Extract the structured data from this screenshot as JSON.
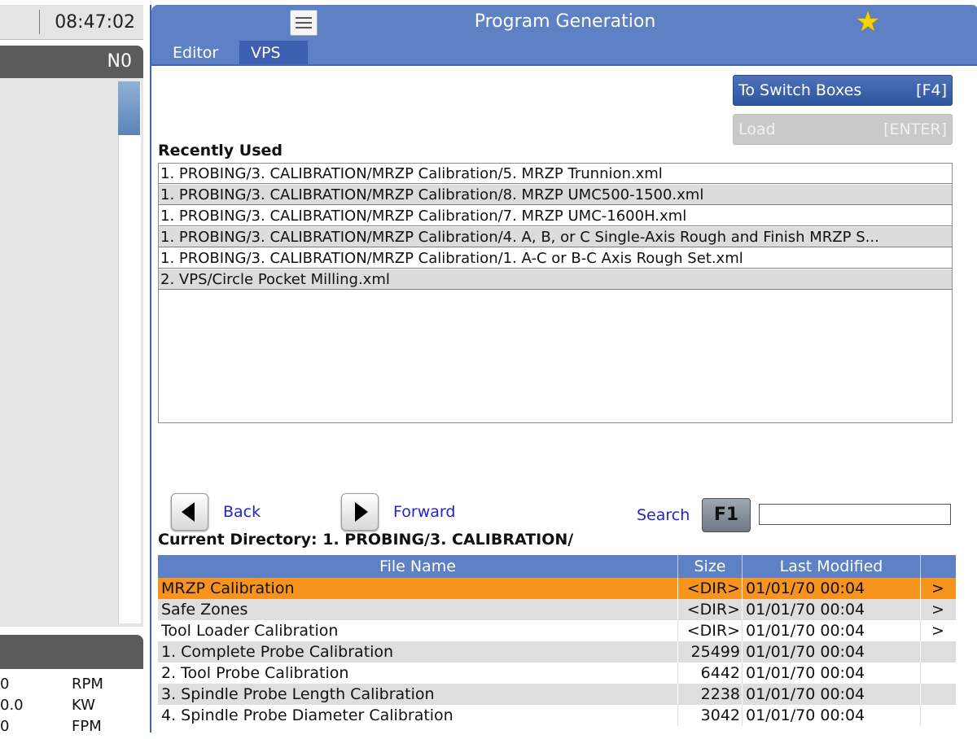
{
  "left_panel": {
    "clock": "08:47:02",
    "n_label": "N0",
    "stats": [
      {
        "value": "0",
        "unit": "RPM"
      },
      {
        "value": "0.0",
        "unit": "KW"
      },
      {
        "value": "0",
        "unit": "FPM"
      }
    ]
  },
  "window": {
    "title": "Program Generation",
    "tabs": [
      {
        "label": "Editor"
      },
      {
        "label": "VPS"
      }
    ],
    "active_tab": "VPS"
  },
  "actions": {
    "switch": {
      "label": "To Switch Boxes",
      "key": "[F4]"
    },
    "load": {
      "label": "Load",
      "key": "[ENTER]"
    }
  },
  "recent": {
    "title": "Recently Used",
    "items": [
      "1. PROBING/3. CALIBRATION/MRZP Calibration/5. MRZP Trunnion.xml",
      "1. PROBING/3. CALIBRATION/MRZP Calibration/8. MRZP UMC500-1500.xml",
      "1. PROBING/3. CALIBRATION/MRZP Calibration/7. MRZP UMC-1600H.xml",
      "1. PROBING/3. CALIBRATION/MRZP Calibration/4. A, B, or C Single-Axis Rough and Finish MRZP S...",
      "1. PROBING/3. CALIBRATION/MRZP Calibration/1. A-C or B-C Axis Rough Set.xml",
      "2. VPS/Circle Pocket Milling.xml"
    ]
  },
  "nav": {
    "back": "Back",
    "forward": "Forward",
    "search_label": "Search",
    "search_key": "F1",
    "search_value": ""
  },
  "current_directory": "Current Directory: 1. PROBING/3. CALIBRATION/",
  "file_table": {
    "columns": {
      "name": "File Name",
      "size": "Size",
      "modified": "Last Modified"
    },
    "rows": [
      {
        "name": "MRZP Calibration",
        "size": "<DIR>",
        "modified": "01/01/70 00:04",
        "arrow": ">"
      },
      {
        "name": "Safe Zones",
        "size": "<DIR>",
        "modified": "01/01/70 00:04",
        "arrow": ">"
      },
      {
        "name": "Tool Loader Calibration",
        "size": "<DIR>",
        "modified": "01/01/70 00:04",
        "arrow": ">"
      },
      {
        "name": "1. Complete Probe Calibration",
        "size": "25499",
        "modified": "01/01/70 00:04",
        "arrow": ""
      },
      {
        "name": "2. Tool Probe Calibration",
        "size": "6442",
        "modified": "01/01/70 00:04",
        "arrow": ""
      },
      {
        "name": "3. Spindle Probe Length Calibration",
        "size": "2238",
        "modified": "01/01/70 00:04",
        "arrow": ""
      },
      {
        "name": "4. Spindle Probe Diameter Calibration",
        "size": "3042",
        "modified": "01/01/70 00:04",
        "arrow": ""
      }
    ],
    "selected_index": 0
  },
  "colors": {
    "title_bar": "#5e80c4",
    "selected_row": "#f7941e",
    "link_text": "#2424c8"
  },
  "icons": {
    "menu": "hamburger-menu-icon",
    "favorite": "star-icon",
    "back": "left-triangle-icon",
    "forward": "right-triangle-icon"
  }
}
